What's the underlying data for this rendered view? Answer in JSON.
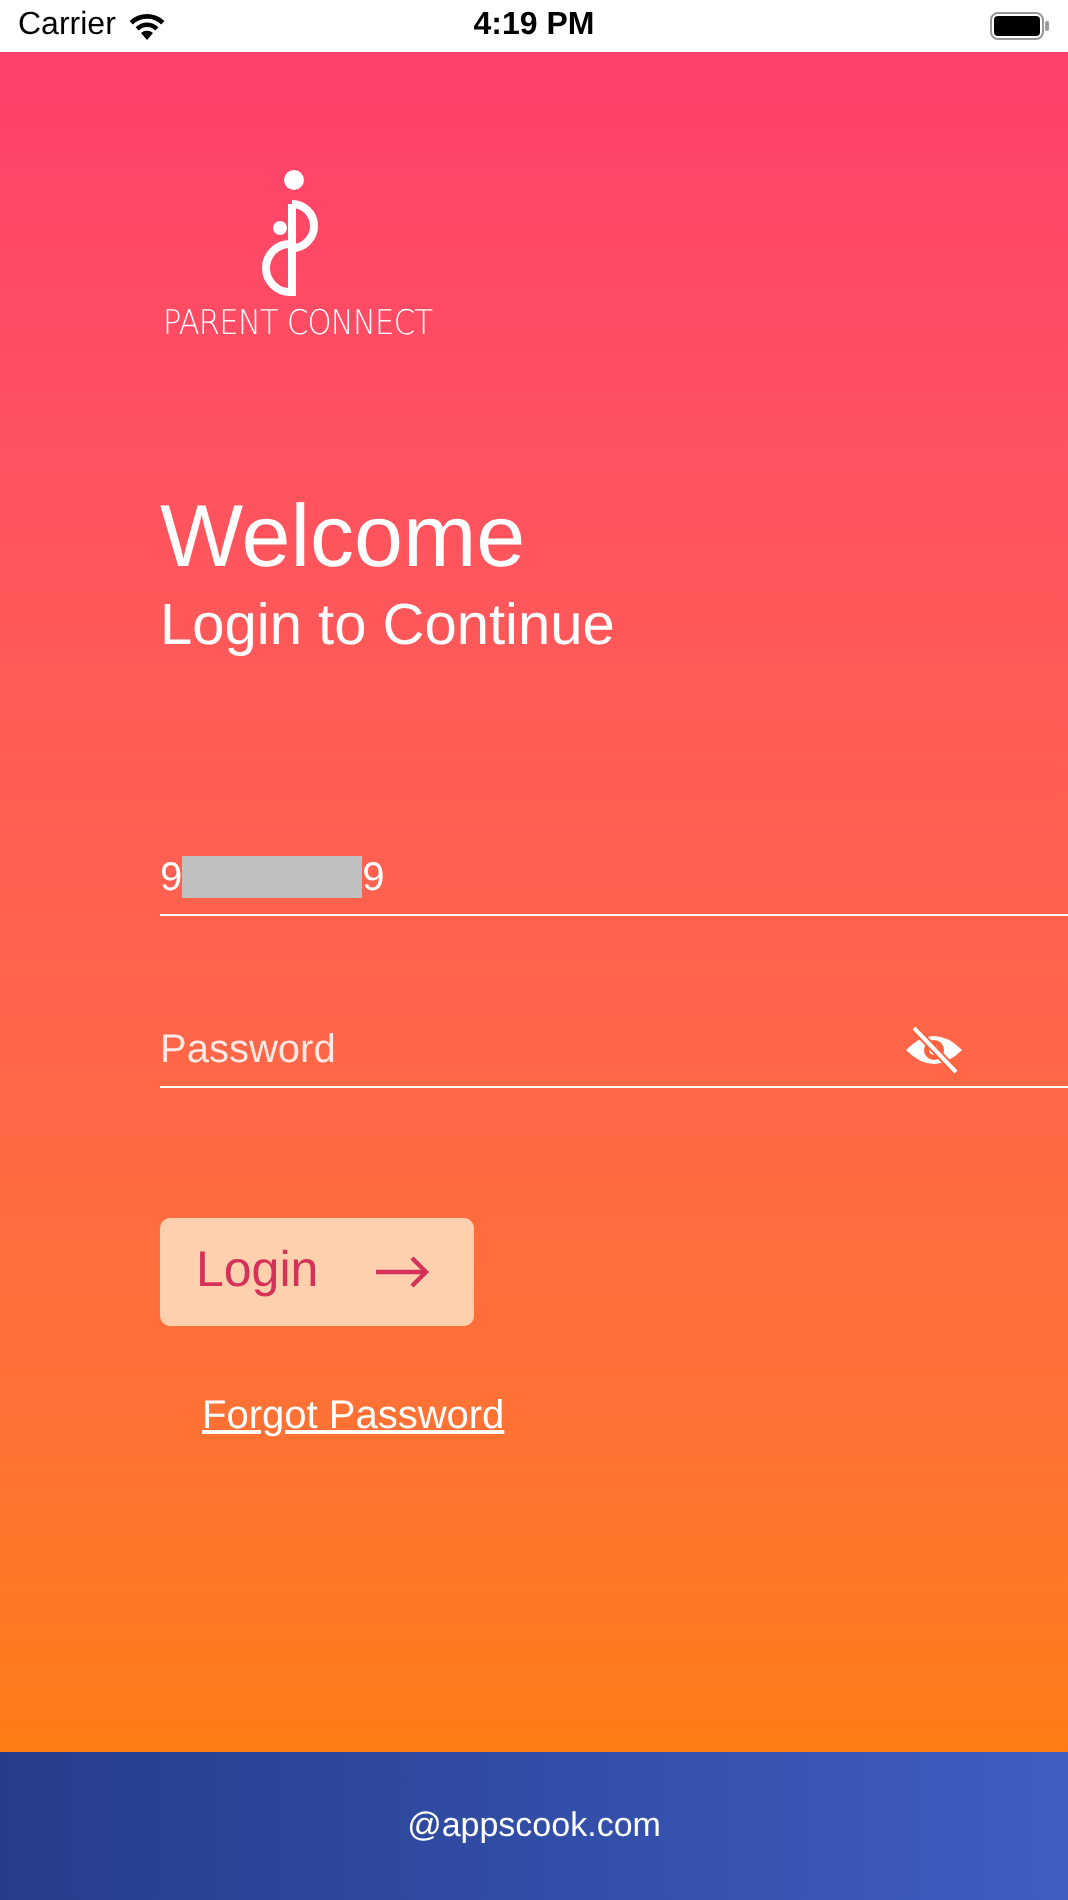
{
  "status_bar": {
    "carrier": "Carrier",
    "time": "4:19 PM"
  },
  "logo": {
    "name": "PARENT CONNECT"
  },
  "heading": {
    "title": "Welcome",
    "subtitle": "Login to Continue"
  },
  "phone_field": {
    "value_start": "9",
    "redacted": true,
    "value_end": "9"
  },
  "password_field": {
    "placeholder": "Password",
    "visible": false
  },
  "login_button": {
    "label": "Login"
  },
  "forgot_link": {
    "label": "Forgot Password"
  },
  "footer": {
    "text": "@appscook.com"
  }
}
